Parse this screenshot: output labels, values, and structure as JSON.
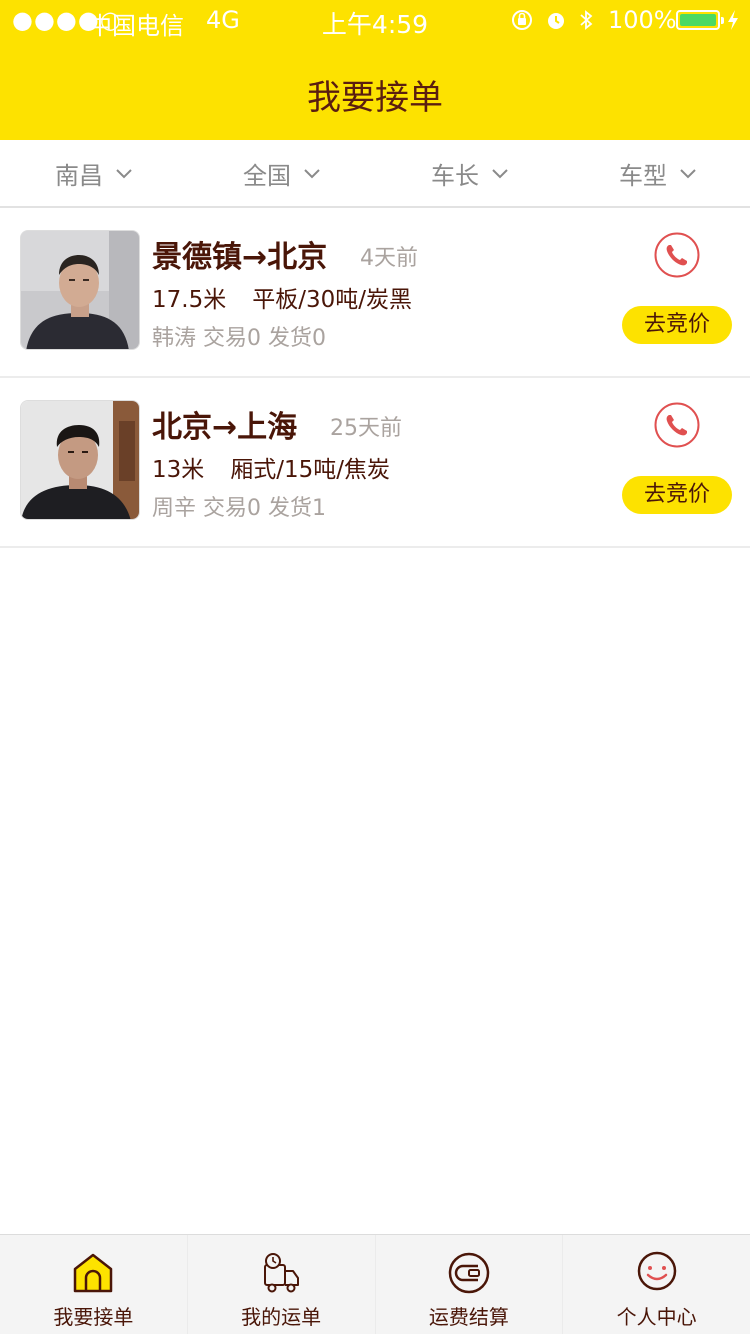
{
  "status_bar": {
    "signal": "●●●●○",
    "carrier": "中国电信",
    "network": "4G",
    "time": "上午4:59",
    "battery_percent": "100%",
    "battery_level": 1.0
  },
  "header": {
    "title": "我要接单"
  },
  "filters": [
    {
      "label": "南昌"
    },
    {
      "label": "全国"
    },
    {
      "label": "车长"
    },
    {
      "label": "车型"
    }
  ],
  "orders": [
    {
      "route": "景德镇→北京",
      "posted": "4天前",
      "length": "17.5米",
      "cargo": "平板/30吨/炭黑",
      "shipper": "韩涛",
      "trades": "交易0",
      "shipments": "发货0",
      "bid_label": "去竞价"
    },
    {
      "route": "北京→上海",
      "posted": "25天前",
      "length": "13米",
      "cargo": "厢式/15吨/焦炭",
      "shipper": "周辛",
      "trades": "交易0",
      "shipments": "发货1",
      "bid_label": "去竞价"
    }
  ],
  "tabs": [
    {
      "label": "我要接单",
      "icon": "home-icon",
      "active": true
    },
    {
      "label": "我的运单",
      "icon": "truck-clock-icon"
    },
    {
      "label": "运费结算",
      "icon": "wallet-icon"
    },
    {
      "label": "个人中心",
      "icon": "smiley-icon"
    }
  ],
  "colors": {
    "brand_yellow": "#fde200",
    "text_brown": "#4a1608",
    "muted_text": "#aaa39f",
    "phone_red": "#e05050",
    "battery_green": "#4cd964"
  }
}
